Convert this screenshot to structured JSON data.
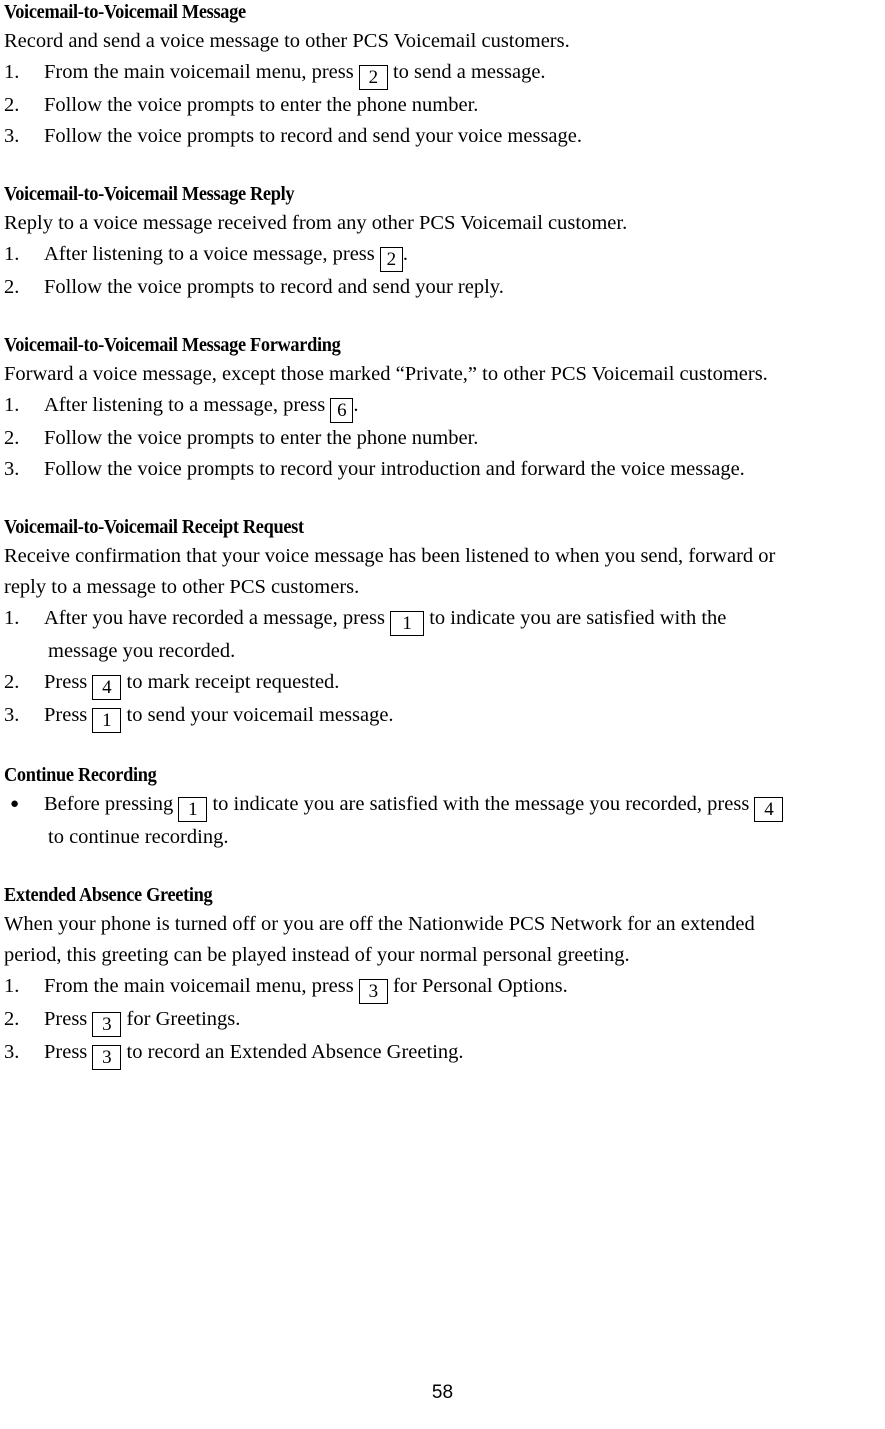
{
  "document": {
    "page_number": "58",
    "sections": [
      {
        "id": "vm-to-vm-message",
        "heading": "Voicemail-to-Voicemail Message",
        "intro": "Record and send a voice message to other PCS Voicemail customers.",
        "list_type": "numbered",
        "items": [
          {
            "marker": "1.",
            "text_before": "From the main voicemail menu, press",
            "key": "2",
            "text_after": "to send a message."
          },
          {
            "marker": "2.",
            "text_before": "Follow the voice prompts to enter the phone number.",
            "key": "",
            "text_after": ""
          },
          {
            "marker": "3.",
            "text_before": "Follow the voice prompts to record and send your voice message.",
            "key": "",
            "text_after": ""
          }
        ]
      },
      {
        "id": "vm-to-vm-message-reply",
        "heading": "Voicemail-to-Voicemail Message Reply",
        "intro": "Reply to a voice message received from any other PCS Voicemail customer.",
        "list_type": "numbered",
        "items": [
          {
            "marker": "1.",
            "text_before": "After listening to a voice message, press",
            "key": "2",
            "text_after": "."
          },
          {
            "marker": "2.",
            "text_before": "Follow the voice prompts to record and send your reply.",
            "key": "",
            "text_after": ""
          }
        ]
      },
      {
        "id": "vm-to-vm-message-forwarding",
        "heading": "Voicemail-to-Voicemail Message Forwarding",
        "intro": "Forward a voice message, except those marked “Private,” to other PCS Voicemail customers.",
        "list_type": "numbered",
        "items": [
          {
            "marker": "1.",
            "text_before": "After listening to a message, press",
            "key": "6",
            "text_after": "."
          },
          {
            "marker": "2.",
            "text_before": "Follow the voice prompts to enter the phone number.",
            "key": "",
            "text_after": ""
          },
          {
            "marker": "3.",
            "text_before": "Follow the voice prompts to record your introduction and forward the voice message.",
            "key": "",
            "text_after": ""
          }
        ]
      },
      {
        "id": "vm-to-vm-receipt-request",
        "heading": "Voicemail-to-Voicemail Receipt Request",
        "intro_line1": "Receive confirmation that your voice message has been listened to when you send, forward or",
        "intro_line2": "reply to a message to other PCS customers.",
        "list_type": "numbered",
        "items": [
          {
            "marker": "1.",
            "text_before": "After you have recorded a message, press",
            "key": "1",
            "text_after": "to indicate you are satisfied with the",
            "continuation": "message you recorded."
          },
          {
            "marker": "2.",
            "text_before": "Press",
            "key": "4",
            "text_after": "to mark receipt requested."
          },
          {
            "marker": "3.",
            "text_before": "Press",
            "key": "1",
            "text_after": "to send your voicemail message."
          }
        ]
      },
      {
        "id": "continue-recording",
        "heading": "Continue Recording",
        "list_type": "bullet",
        "items": [
          {
            "marker": "●",
            "text_before": "Before pressing",
            "key": "1",
            "text_after": "to indicate you are satisfied with the message you recorded, press",
            "key2": "4",
            "continuation": "to continue recording."
          }
        ]
      },
      {
        "id": "extended-absence-greeting",
        "heading": "Extended Absence Greeting",
        "intro_line1": "When your phone is turned off or you are off the Nationwide PCS Network for an extended",
        "intro_line2": "period, this greeting can be played instead of your normal personal greeting.",
        "list_type": "numbered",
        "items": [
          {
            "marker": "1.",
            "text_before": "From the main voicemail menu, press",
            "key": "3",
            "text_after": "for Personal Options."
          },
          {
            "marker": "2.",
            "text_before": "Press",
            "key": "3",
            "text_after": "for Greetings."
          },
          {
            "marker": "3.",
            "text_before": "Press",
            "key": "3",
            "text_after": "to record an Extended Absence Greeting."
          }
        ]
      }
    ]
  }
}
